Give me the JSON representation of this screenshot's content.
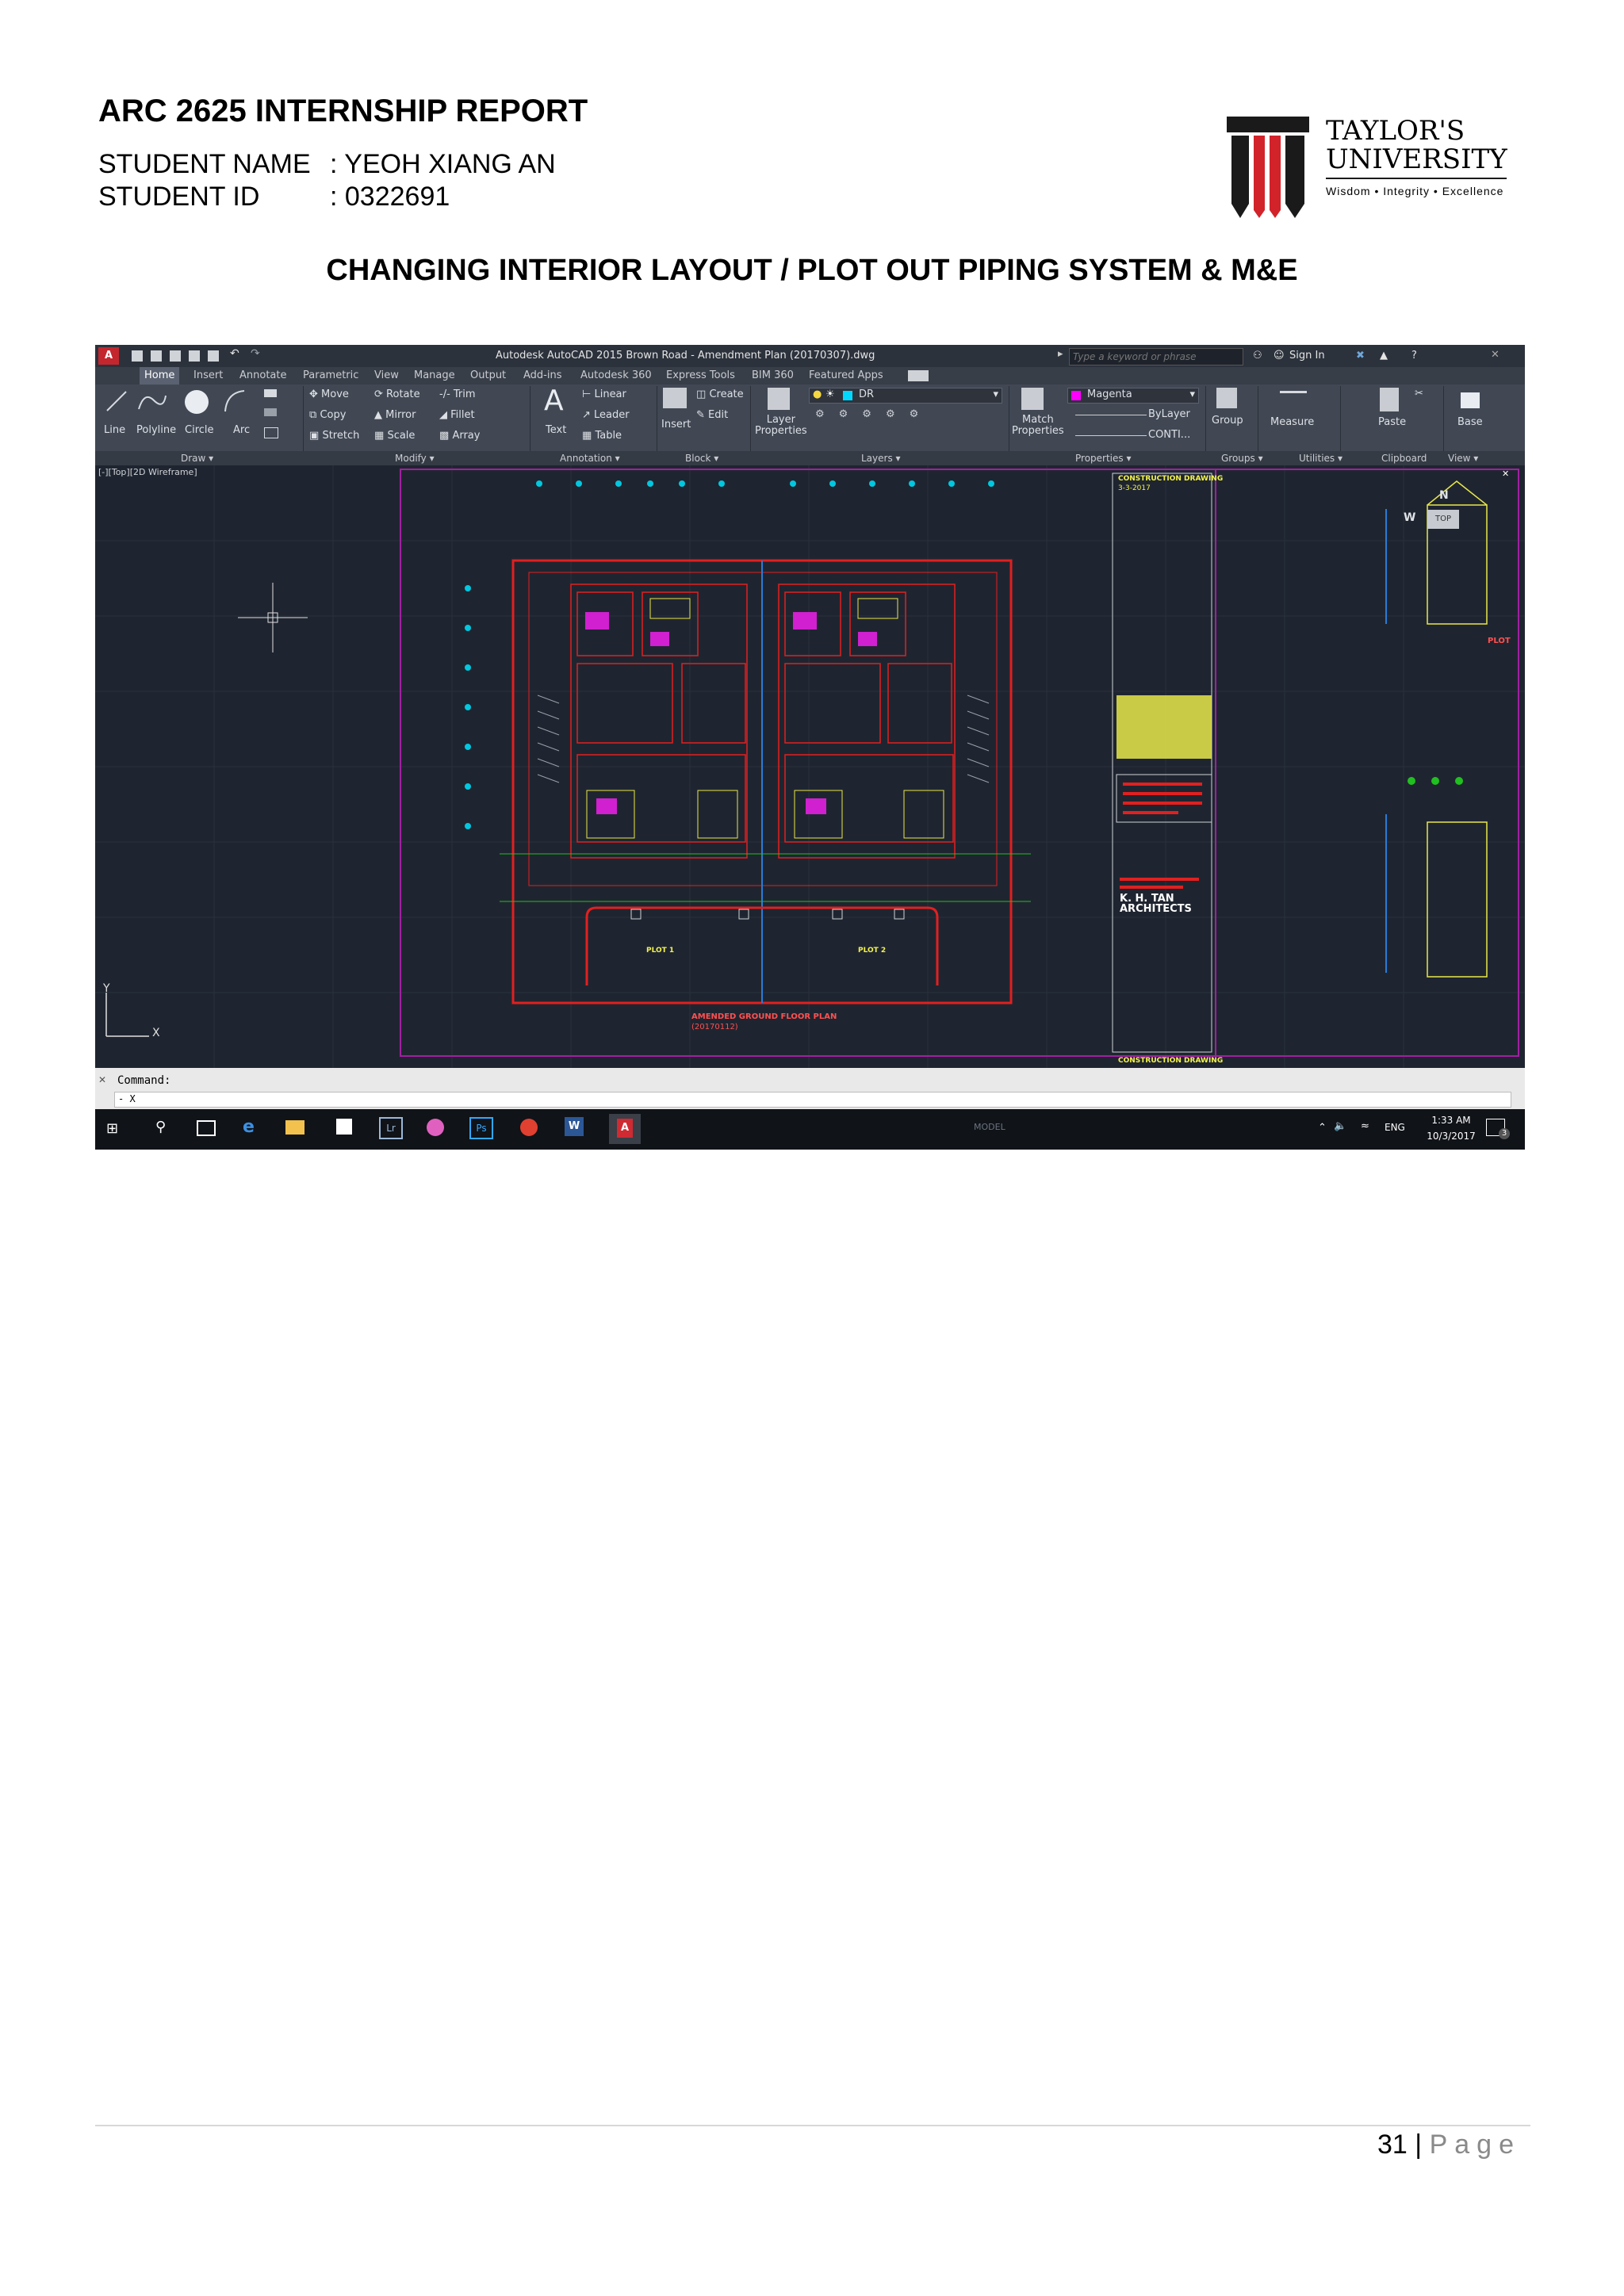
{
  "header": {
    "title": "ARC 2625 INTERNSHIP REPORT",
    "student_name_label": "STUDENT NAME",
    "student_name_value": ": YEOH XIANG AN",
    "student_id_label": "STUDENT ID",
    "student_id_value": ": 0322691"
  },
  "logo": {
    "line1": "TAYLOR'S",
    "line2": "UNIVERSITY",
    "tagline": "Wisdom • Integrity • Excellence",
    "colors": {
      "red": "#d2232a",
      "black": "#1a1a1a"
    }
  },
  "section_title": "CHANGING INTERIOR LAYOUT / PLOT OUT PIPING SYSTEM & M&E",
  "autocad": {
    "window_title": "Autodesk AutoCAD 2015    Brown Road - Amendment Plan (20170307).dwg",
    "search_placeholder": "Type a keyword or phrase",
    "sign_in": "Sign In",
    "tabs": [
      "Home",
      "Insert",
      "Annotate",
      "Parametric",
      "View",
      "Manage",
      "Output",
      "Add-ins",
      "Autodesk 360",
      "Express Tools",
      "BIM 360",
      "Featured Apps"
    ],
    "draw": {
      "line": "Line",
      "polyline": "Polyline",
      "circle": "Circle",
      "arc": "Arc"
    },
    "modify": {
      "move": "Move",
      "rotate": "Rotate",
      "trim": "Trim",
      "copy": "Copy",
      "mirror": "Mirror",
      "fillet": "Fillet",
      "stretch": "Stretch",
      "scale": "Scale",
      "array": "Array"
    },
    "annotation": {
      "text": "Text",
      "linear": "Linear",
      "leader": "Leader",
      "table": "Table"
    },
    "block": {
      "insert": "Insert",
      "create": "Create",
      "edit": "Edit"
    },
    "layers": {
      "layer_properties": "Layer\nProperties",
      "current_layer": "DR"
    },
    "properties": {
      "match": "Match\nProperties",
      "color": "Magenta",
      "linetype": "ByLayer",
      "lineweight": "CONTI..."
    },
    "groups": {
      "group": "Group"
    },
    "utilities": {
      "measure": "Measure"
    },
    "clipboard": {
      "paste": "Paste"
    },
    "view": {
      "base": "Base"
    },
    "panel_labels": [
      "Draw",
      "Modify",
      "Annotation",
      "Block",
      "Layers",
      "Properties",
      "Groups",
      "Utilities",
      "Clipboard",
      "View"
    ],
    "viewport_label": "[-][Top][2D Wireframe]",
    "plan_title": "AMENDED GROUND FLOOR PLAN",
    "plan_date": "(20170112)",
    "plot1": "PLOT 1",
    "plot2": "PLOT 2",
    "titleblock_header": "CONSTRUCTION DRAWING",
    "titleblock_date": "3-3-2017",
    "titleblock_firm": "K. H. TAN\nARCHITECTS",
    "titleblock_footer": "CONSTRUCTION DRAWING",
    "viewcube_top": "TOP",
    "compass_n": "N",
    "compass_w": "W",
    "side_label": "PLOT",
    "command_label": "Command:",
    "command_input": "- X",
    "axis_y": "Y",
    "axis_x": "X",
    "status_model": "MODEL",
    "tray_lang": "ENG",
    "clock_time": "1:33 AM",
    "clock_date": "10/3/2017",
    "notifications": "3"
  },
  "footer": {
    "page_number": "31",
    "separator": "|",
    "page_word": "Page"
  }
}
